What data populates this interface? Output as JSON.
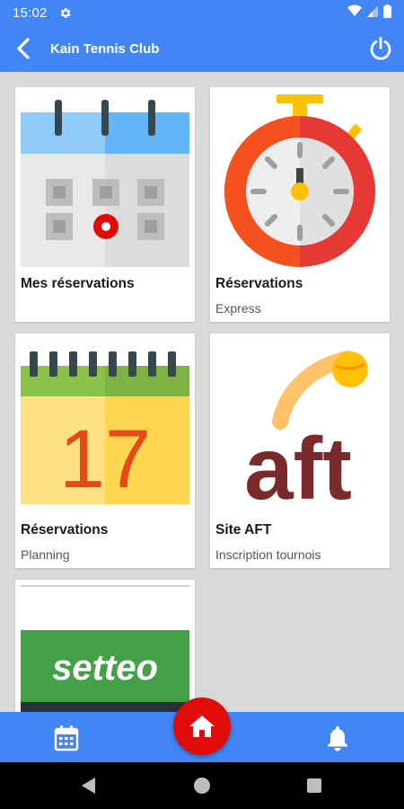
{
  "status_bar": {
    "time": "15:02"
  },
  "app_bar": {
    "title": "Kain Tennis Club"
  },
  "tiles": [
    {
      "title": "Mes réservations",
      "subtitle": "",
      "icon": "calendar-icon"
    },
    {
      "title": "Réservations",
      "subtitle": "Express",
      "icon": "stopwatch-icon"
    },
    {
      "title": "Réservations",
      "subtitle": "Planning",
      "icon": "calendar-17-icon",
      "day": "17"
    },
    {
      "title": "Site AFT",
      "subtitle": "Inscription tournois",
      "icon": "aft-logo",
      "logo_text": "aft"
    },
    {
      "title": "",
      "subtitle": "",
      "icon": "setteo-logo",
      "logo_text": "setteo"
    }
  ],
  "bottom_nav": {
    "left_icon": "calendar-icon",
    "center_icon": "home-icon",
    "right_icon": "bell-icon"
  },
  "colors": {
    "primary": "#4285f4",
    "fab": "#e00b0b",
    "background": "#d9d9d9"
  }
}
